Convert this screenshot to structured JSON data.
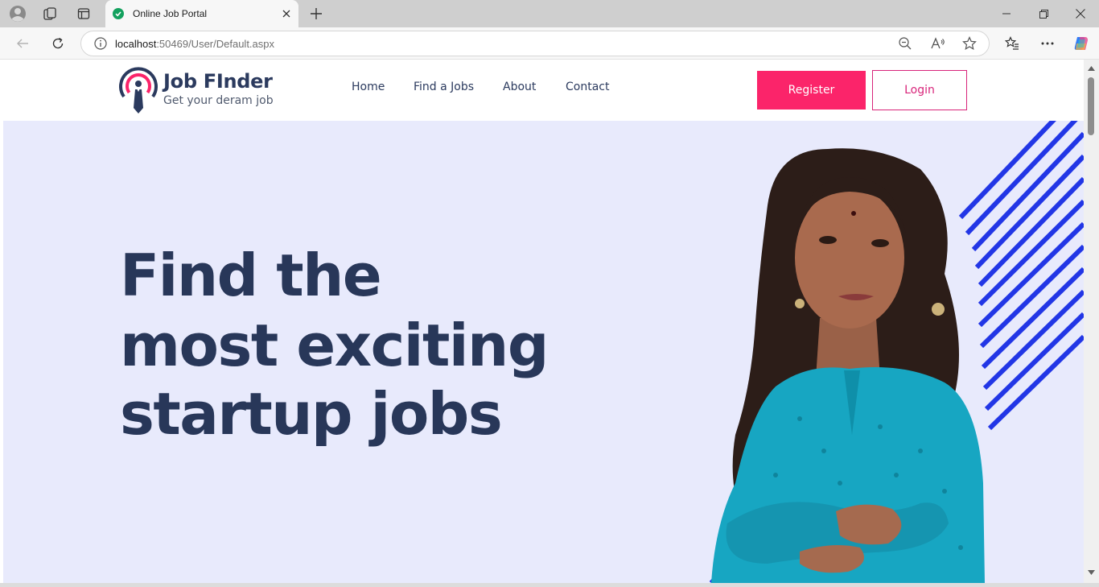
{
  "browser": {
    "tab_title": "Online Job Portal",
    "url_host": "localhost",
    "url_rest": ":50469/User/Default.aspx"
  },
  "site": {
    "logo_title": "Job FInder",
    "logo_tagline": "Get your deram job",
    "nav": {
      "home": "Home",
      "find_jobs": "Find a Jobs",
      "about": "About",
      "contact": "Contact"
    },
    "register_label": "Register",
    "login_label": "Login"
  },
  "hero": {
    "line1": "Find the",
    "line2": "most exciting",
    "line3": "startup jobs"
  },
  "colors": {
    "accent": "#fb246a",
    "heading": "#283759",
    "hero_bg": "#e8eafc",
    "stripe": "#2236e6"
  }
}
